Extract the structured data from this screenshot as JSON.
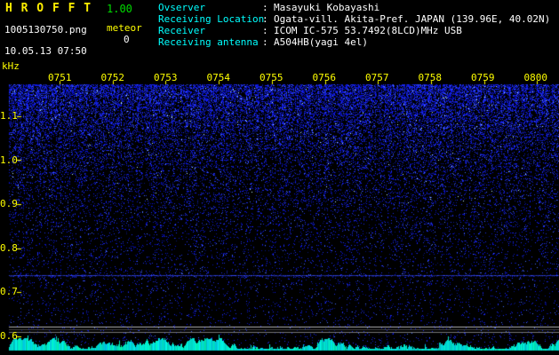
{
  "header": {
    "app_title": "H R O F F T",
    "version": "1.00",
    "filename": "1005130750.png",
    "mode_label": "meteor",
    "meteor_count": "0",
    "datetime": "10.05.13 07:50"
  },
  "info": {
    "separator": ":",
    "rows": [
      {
        "label": "Ovserver",
        "value": "Masayuki Kobayashi"
      },
      {
        "label": "Receiving Location",
        "value": "Ogata-vill. Akita-Pref. JAPAN (139.96E, 40.02N)"
      },
      {
        "label": "Receiver",
        "value": "ICOM IC-575 53.7492(8LCD)MHz USB"
      },
      {
        "label": "Receiving antenna",
        "value": "A504HB(yagi 4el)"
      }
    ]
  },
  "spectrogram": {
    "unit_label": "kHz",
    "time_labels": [
      "0751",
      "0752",
      "0753",
      "0754",
      "0755",
      "0756",
      "0757",
      "0758",
      "0759",
      "0800"
    ],
    "freq_labels": [
      "1.1",
      "1.0",
      "0.9",
      "0.8",
      "0.7",
      "0.6"
    ],
    "signal_line_freq_khz": 0.73
  },
  "colors": {
    "accent_yellow": "#ffff00",
    "version_green": "#00dd00",
    "label_cyan": "#00ffff",
    "text_white": "#ffffff",
    "noise_blue": "#0810e6",
    "signal_blue": "#374bff",
    "meter_cyan": "#00ffdc",
    "grid_gray": "#afafaf"
  }
}
